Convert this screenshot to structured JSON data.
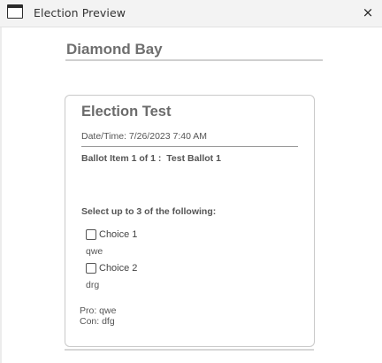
{
  "window": {
    "title": "Election Preview",
    "close_label": "×"
  },
  "organization": {
    "name": "Diamond Bay"
  },
  "election": {
    "title": "Election Test",
    "datetime": "Date/Time: 7/26/2023 7:40 AM",
    "ballot_item": "Ballot Item 1 of 1 :  Test Ballot 1",
    "instruction": "Select up to 3 of the following:",
    "choices": [
      {
        "label": "Choice 1",
        "description": "qwe",
        "checked": false
      },
      {
        "label": "Choice 2",
        "description": "drg",
        "checked": false
      }
    ],
    "pro": "Pro: qwe",
    "con": "Con: dfg"
  }
}
